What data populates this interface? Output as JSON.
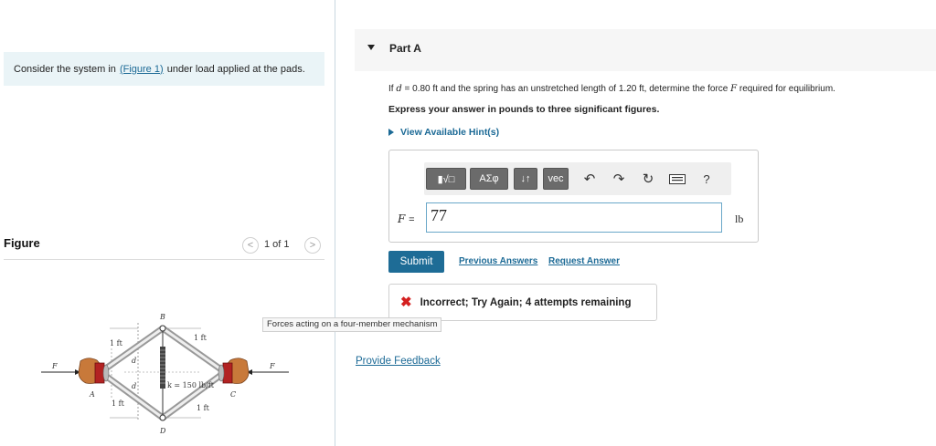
{
  "intro": {
    "text_before": "Consider the system in",
    "figure_link": "(Figure 1)",
    "text_after": "under load applied at the pads."
  },
  "figure": {
    "title": "Figure",
    "pager": "1 of 1",
    "prev_icon": "chevron-left-icon",
    "next_icon": "chevron-right-icon",
    "caption": "Forces acting on a four-member mechanism",
    "labels": {
      "B": "B",
      "D": "D",
      "A": "A",
      "C": "C",
      "F_left": "F",
      "F_right": "F",
      "d_upper": "d",
      "d_lower": "d",
      "ft_top_left": "1 ft",
      "ft_top_right": "1 ft",
      "ft_bottom_left": "1 ft",
      "ft_bottom_right": "1 ft",
      "spring": "k = 150 lb/ft"
    }
  },
  "part": {
    "title": "Part A",
    "collapse_icon": "caret-down-icon"
  },
  "question": {
    "prefix": "If",
    "d_symbol": "d",
    "d_value": " = 0.80 ft and the spring has an unstretched length of 1.20 ft, determine the force",
    "f_symbol": "F",
    "suffix": "required for equilibrium."
  },
  "instruction": "Express your answer in pounds to three significant figures.",
  "hint": {
    "label": "View Available Hint(s)",
    "icon": "caret-right-icon"
  },
  "toolbar": {
    "templates_icon": "templates-icon",
    "greek": "ΑΣφ",
    "arrows": "↓↑",
    "vec": "vec",
    "undo_icon": "undo-icon",
    "redo_icon": "redo-icon",
    "reset_icon": "reset-icon",
    "keyboard_icon": "keyboard-icon",
    "help": "?"
  },
  "answer": {
    "variable": "F",
    "equals": "=",
    "value": "77",
    "unit": "lb"
  },
  "actions": {
    "submit": "Submit",
    "previous_answers": "Previous Answers",
    "request_answer": "Request Answer"
  },
  "feedback": {
    "icon": "close-icon",
    "mark": "✖",
    "message": "Incorrect; Try Again; 4 attempts remaining",
    "color": "#d42020"
  },
  "provide_feedback": "Provide Feedback",
  "colors": {
    "link": "#1c6a96",
    "accent": "#1e6c96",
    "intro_bg": "#eaf4f7"
  }
}
